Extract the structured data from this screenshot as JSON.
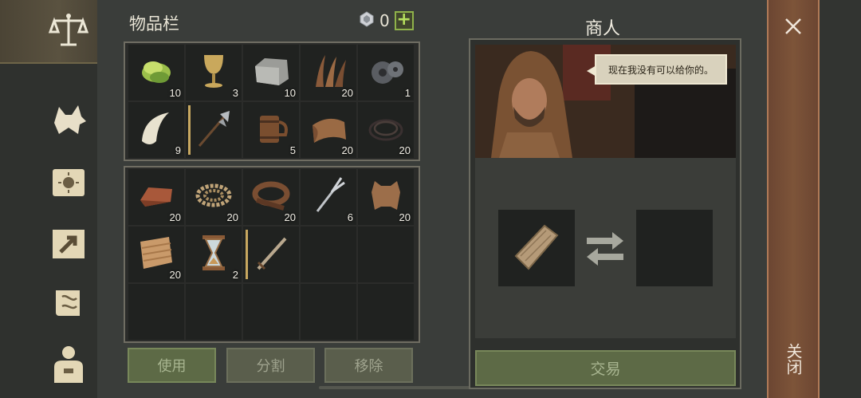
{
  "inventory": {
    "title": "物品栏",
    "currency_value": "0",
    "top_items": [
      {
        "icon": "food-leaves-icon",
        "count": "10"
      },
      {
        "icon": "goblet-icon",
        "count": "3"
      },
      {
        "icon": "stone-block-icon",
        "count": "10"
      },
      {
        "icon": "fibers-icon",
        "count": "20"
      },
      {
        "icon": "gears-icon",
        "count": "1"
      },
      {
        "icon": "fang-icon",
        "count": "9"
      },
      {
        "icon": "halberd-icon",
        "count": "",
        "equipped": true
      },
      {
        "icon": "tankard-icon",
        "count": "5"
      },
      {
        "icon": "leather-scroll-icon",
        "count": "20"
      },
      {
        "icon": "cord-icon",
        "count": "20"
      }
    ],
    "bottom_items": [
      {
        "icon": "copper-ingot-icon",
        "count": "20"
      },
      {
        "icon": "rope-icon",
        "count": "20"
      },
      {
        "icon": "leather-strap-icon",
        "count": "20"
      },
      {
        "icon": "fork-tool-icon",
        "count": "6"
      },
      {
        "icon": "hide-icon",
        "count": "20"
      },
      {
        "icon": "cloth-icon",
        "count": "20"
      },
      {
        "icon": "hourglass-icon",
        "count": "2"
      },
      {
        "icon": "sword-icon",
        "count": "",
        "equipped": true
      },
      {
        "icon": "",
        "count": ""
      },
      {
        "icon": "",
        "count": ""
      },
      {
        "icon": "",
        "count": ""
      },
      {
        "icon": "",
        "count": ""
      },
      {
        "icon": "",
        "count": ""
      },
      {
        "icon": "",
        "count": ""
      },
      {
        "icon": "",
        "count": ""
      }
    ],
    "buttons": {
      "use": "使用",
      "split": "分割",
      "remove": "移除"
    }
  },
  "merchant": {
    "title": "商人",
    "speech": "现在我没有可以给你的。",
    "trade_button": "交易"
  },
  "close": {
    "label": "关闭"
  }
}
